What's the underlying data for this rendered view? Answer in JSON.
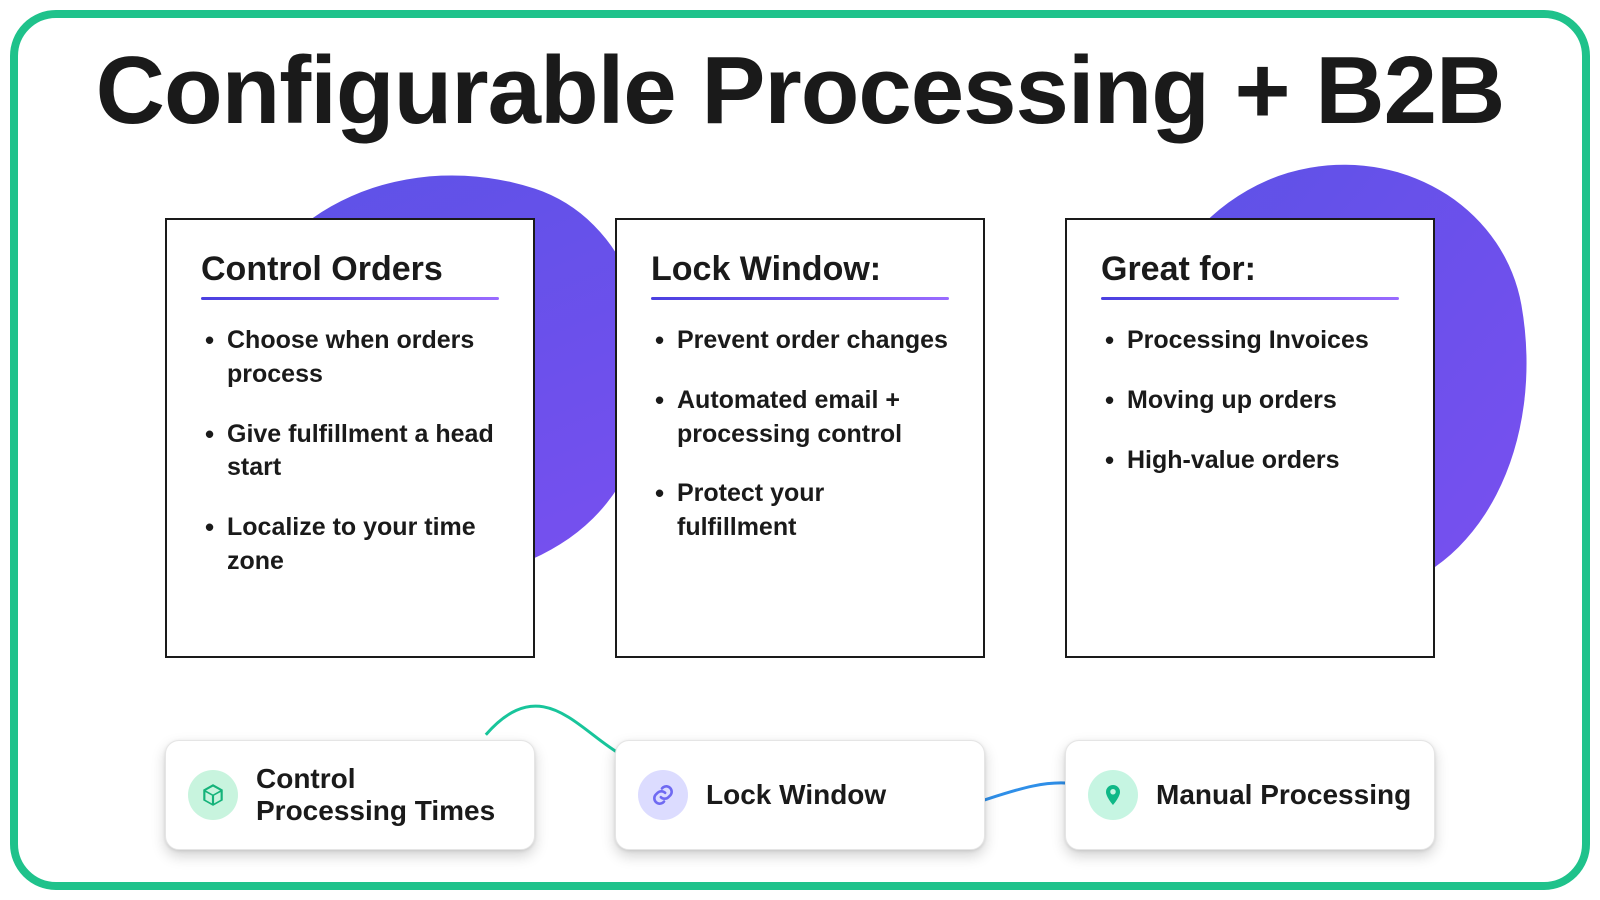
{
  "title": "Configurable Processing + B2B",
  "cards": [
    {
      "heading": "Control Orders",
      "items": [
        "Choose when orders process",
        "Give fulfillment a head start",
        "Localize to your time zone"
      ]
    },
    {
      "heading": "Lock Window:",
      "items": [
        "Prevent order changes",
        "Automated email + processing control",
        "Protect your fulfillment"
      ]
    },
    {
      "heading": "Great for:",
      "items": [
        "Processing Invoices",
        "Moving up orders",
        "High-value orders"
      ]
    }
  ],
  "pills": [
    {
      "icon": "box-icon",
      "label": "Control Processing Times"
    },
    {
      "icon": "link-icon",
      "label": "Lock Window"
    },
    {
      "icon": "pin-icon",
      "label": "Manual Processing"
    }
  ],
  "colors": {
    "frame_border": "#1fc28b",
    "blob_gradient_from": "#5b52e6",
    "blob_gradient_to": "#7a4ff0",
    "card_underline_from": "#4a3fe0",
    "card_underline_to": "#9a6bff"
  }
}
